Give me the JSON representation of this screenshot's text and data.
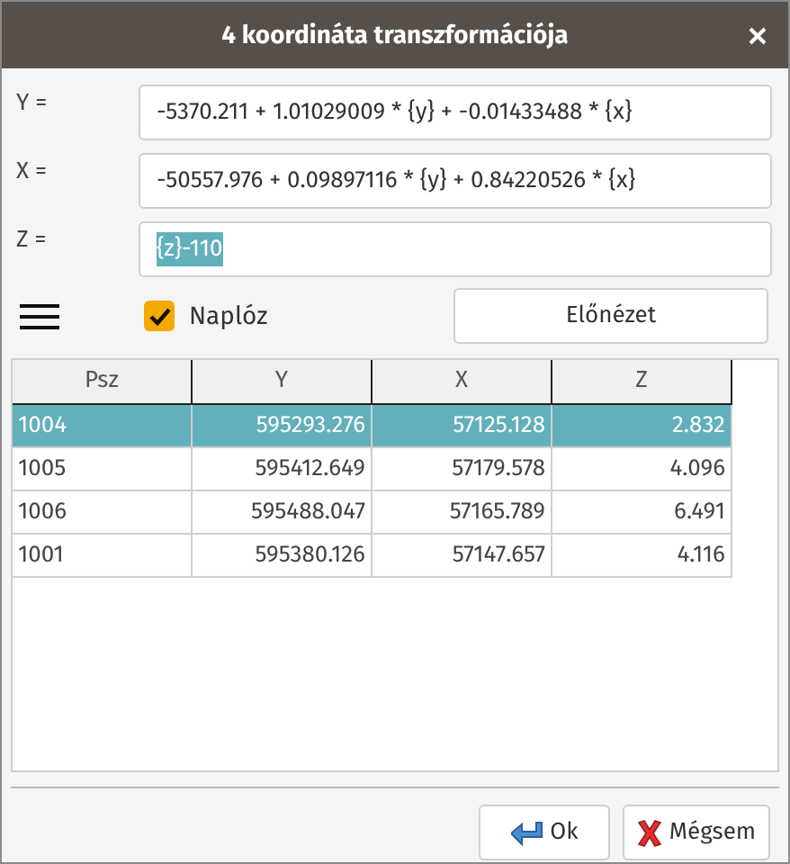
{
  "window": {
    "title": "4 koordináta transzformációja"
  },
  "fields": [
    {
      "label": "Y =",
      "value": "-5370.211 + 1.01029009 * {y} + -0.01433488 * {x}",
      "selected": false
    },
    {
      "label": "X =",
      "value": "-50557.976 + 0.09897116 * {y} + 0.84220526 * {x}",
      "selected": false
    },
    {
      "label": "Z =",
      "value": "{z}-110",
      "selected": true
    }
  ],
  "log_checkbox": {
    "label": "Naplóz",
    "checked": true
  },
  "preview_button": "Előnézet",
  "table": {
    "columns": [
      "Psz",
      "Y",
      "X",
      "Z"
    ],
    "rows": [
      {
        "cells": [
          "1004",
          "595293.276",
          "57125.128",
          "2.832"
        ],
        "selected": true
      },
      {
        "cells": [
          "1005",
          "595412.649",
          "57179.578",
          "4.096"
        ],
        "selected": false
      },
      {
        "cells": [
          "1006",
          "595488.047",
          "57165.789",
          "6.491"
        ],
        "selected": false
      },
      {
        "cells": [
          "1001",
          "595380.126",
          "57147.657",
          "4.116"
        ],
        "selected": false
      }
    ]
  },
  "buttons": [
    {
      "kind": "ok",
      "label": "Ok"
    },
    {
      "kind": "cancel",
      "label": "Mégsem"
    }
  ]
}
